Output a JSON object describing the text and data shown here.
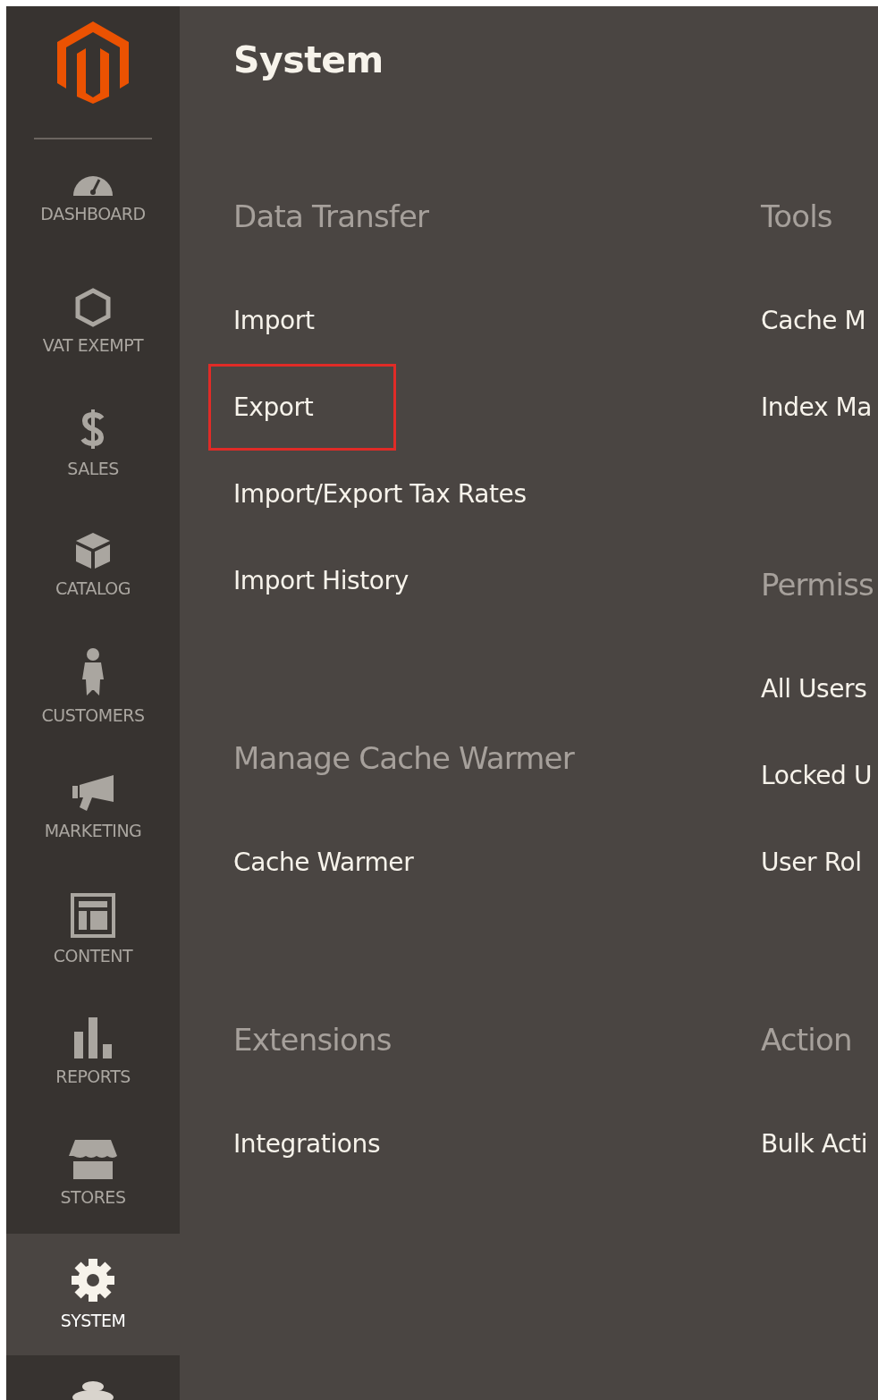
{
  "sidebar": {
    "items": [
      {
        "label": "DASHBOARD",
        "selected": false
      },
      {
        "label": "VAT EXEMPT",
        "selected": false
      },
      {
        "label": "SALES",
        "selected": false
      },
      {
        "label": "CATALOG",
        "selected": false
      },
      {
        "label": "CUSTOMERS",
        "selected": false
      },
      {
        "label": "MARKETING",
        "selected": false
      },
      {
        "label": "CONTENT",
        "selected": false
      },
      {
        "label": "REPORTS",
        "selected": false
      },
      {
        "label": "STORES",
        "selected": false
      },
      {
        "label": "SYSTEM",
        "selected": true
      }
    ]
  },
  "panel": {
    "title": "System",
    "columns": [
      {
        "groups": [
          {
            "heading": "Data Transfer",
            "items": [
              {
                "label": "Import",
                "highlighted": false
              },
              {
                "label": "Export",
                "highlighted": true
              },
              {
                "label": "Import/Export Tax Rates",
                "highlighted": false
              },
              {
                "label": "Import History",
                "highlighted": false
              }
            ]
          },
          {
            "heading": "Manage Cache Warmer",
            "items": [
              {
                "label": "Cache Warmer",
                "highlighted": false
              }
            ]
          },
          {
            "heading": "Extensions",
            "items": [
              {
                "label": "Integrations",
                "highlighted": false
              }
            ]
          }
        ]
      },
      {
        "groups": [
          {
            "heading": "Tools",
            "items": [
              {
                "label": "Cache M",
                "highlighted": false
              },
              {
                "label": "Index Ma",
                "highlighted": false
              }
            ]
          },
          {
            "heading": "Permiss",
            "items": [
              {
                "label": "All Users",
                "highlighted": false
              },
              {
                "label": "Locked U",
                "highlighted": false
              },
              {
                "label": "User Rol",
                "highlighted": false
              }
            ]
          },
          {
            "heading": "Action",
            "items": [
              {
                "label": "Bulk Acti",
                "highlighted": false
              }
            ]
          }
        ]
      }
    ]
  }
}
